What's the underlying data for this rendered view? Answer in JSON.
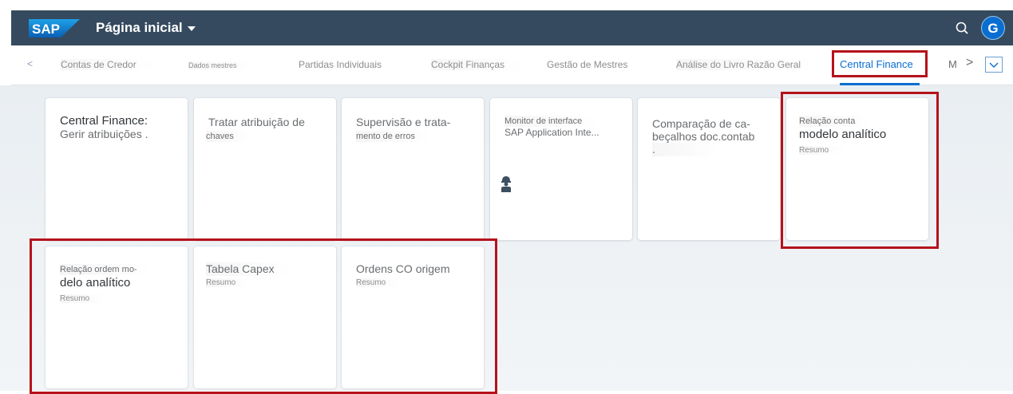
{
  "shell": {
    "logo_text": "SAP",
    "title": "Página inicial",
    "user_initial": "G"
  },
  "tabs": {
    "prev": "<",
    "items": [
      {
        "label": "Contas de Credor"
      },
      {
        "label": "Dados mestres"
      },
      {
        "label": "Partidas Individuais"
      },
      {
        "label": "Cockpit Finanças"
      },
      {
        "label": "Gestão de Mestres"
      },
      {
        "label": "Análise do Livro Razão Geral"
      },
      {
        "label": "Central Finance"
      }
    ],
    "overflow": "M",
    "next": ">"
  },
  "tiles": [
    {
      "line1": "Central Finance:",
      "line2": "Gerir atribuições ."
    },
    {
      "line1": "Tratar atribuição de",
      "line2": "chaves"
    },
    {
      "line1": "Supervisão e trata-",
      "line2": "mento de erros"
    },
    {
      "line1": "Monitor de interface",
      "line2": "SAP Application Inte..."
    },
    {
      "line1": "Comparação de ca-",
      "line2": "beçalhos doc.contab",
      "line3": "."
    },
    {
      "line1": "Relação conta",
      "line2": "modelo analítico",
      "sub": "Resumo"
    },
    {
      "line1": "Relação ordem mo-",
      "line2": "delo analítico",
      "sub": "Resumo"
    },
    {
      "line1": "Tabela Capex",
      "sub": "Resumo"
    },
    {
      "line1": "Ordens CO origem",
      "sub": "Resumo"
    }
  ],
  "colors": {
    "shell_bg": "#354a5f",
    "accent": "#0a6ed1",
    "highlight_box": "#b5121b"
  }
}
